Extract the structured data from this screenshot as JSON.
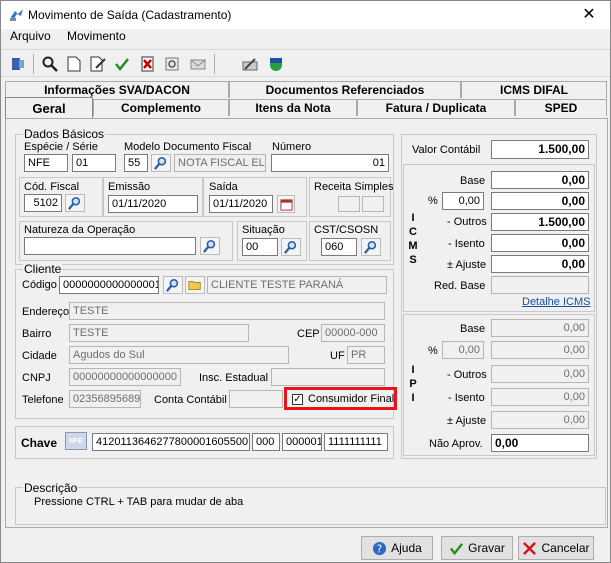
{
  "window": {
    "title": "Movimento de Saída (Cadastramento)",
    "close_label": "✕"
  },
  "menu": {
    "arquivo": "Arquivo",
    "movimento": "Movimento"
  },
  "tabs_top": {
    "info": "Informações SVA/DACON",
    "docs": "Documentos Referenciados",
    "icms_difal": "ICMS DIFAL"
  },
  "tabs_bottom": {
    "geral": "Geral",
    "complemento": "Complemento",
    "itens": "Itens da Nota",
    "fatura": "Fatura / Duplicata",
    "sped": "SPED"
  },
  "dados": {
    "title": "Dados Básicos",
    "especie_serie_label": "Espécie  /  Série",
    "especie": "NFE",
    "serie": "01",
    "modelo_label": "Modelo Documento Fiscal",
    "modelo": "55",
    "modelo_desc": "NOTA FISCAL EL",
    "numero_label": "Número",
    "numero": "01",
    "cod_fiscal_label": "Cód. Fiscal",
    "cod_fiscal": "5102",
    "emissao_label": "Emissão",
    "emissao": "01/11/2020",
    "saida_label": "Saída",
    "saida": "01/11/2020",
    "receita_label": "Receita Simples",
    "natureza_label": "Natureza da Operação",
    "natureza": "",
    "situacao_label": "Situação",
    "situacao": "00",
    "cst_label": "CST/CSOSN",
    "cst": "060"
  },
  "cliente": {
    "title": "Cliente",
    "codigo_label": "Código",
    "codigo": "0000000000000001",
    "nome": "CLIENTE TESTE PARANÁ",
    "endereco_label": "Endereço",
    "endereco": "TESTE",
    "bairro_label": "Bairro",
    "bairro": "TESTE",
    "cep_label": "CEP",
    "cep": "00000-000",
    "cidade_label": "Cidade",
    "cidade": "Agudos do Sul",
    "uf_label": "UF",
    "uf": "PR",
    "cnpj_label": "CNPJ",
    "cnpj": "00000000000000000",
    "ie_label": "Insc. Estadual",
    "ie": "",
    "telefone_label": "Telefone",
    "telefone": "02356895689",
    "conta_label": "Conta Contábil",
    "conta": "",
    "consumidor_label": "Consumidor Final",
    "consumidor_checked": "✓"
  },
  "chave": {
    "label": "Chave",
    "nfe_badge": "NFE",
    "key": "41201136462778000016055001",
    "p2": "000",
    "p3": "000001",
    "p4": "1111111111"
  },
  "descricao": {
    "title": "Descrição",
    "text": "Pressione CTRL + TAB para  mudar de aba"
  },
  "totais": {
    "valor_contabil_label": "Valor Contábil",
    "valor_contabil": "1.500,00",
    "icms_vertical": [
      "I",
      "C",
      "M",
      "S"
    ],
    "icms": {
      "base_label": "Base",
      "base": "0,00",
      "pct_label": "%",
      "pct": "0,00",
      "pct_val": "0,00",
      "outros_label": "- Outros",
      "outros": "1.500,00",
      "isento_label": "- Isento",
      "isento": "0,00",
      "ajuste_label": "± Ajuste",
      "ajuste": "0,00",
      "red_label": "Red. Base",
      "red": "",
      "detalhe": "Detalhe ICMS"
    },
    "ipi_vertical": [
      "I",
      "P",
      "I"
    ],
    "ipi": {
      "base_label": "Base",
      "base": "0,00",
      "pct_label": "%",
      "pct": "0,00",
      "pct_val": "0,00",
      "outros_label": "- Outros",
      "outros": "0,00",
      "isento_label": "- Isento",
      "isento": "0,00",
      "ajuste_label": "± Ajuste",
      "ajuste": "0,00",
      "nao_aprov_label": "Não Aprov.",
      "nao_aprov": "0,00"
    }
  },
  "buttons": {
    "ajuda": "Ajuda",
    "gravar": "Gravar",
    "cancelar": "Cancelar"
  },
  "colors": {
    "highlight": "#e8141b",
    "link": "#1a4fa0"
  }
}
